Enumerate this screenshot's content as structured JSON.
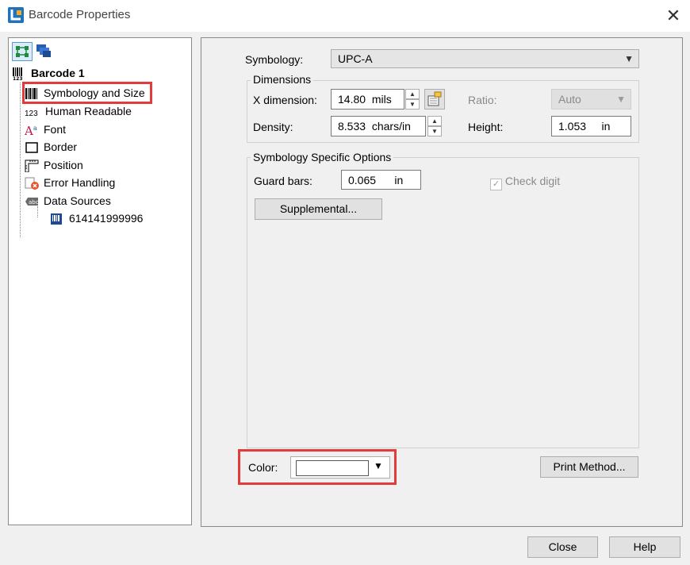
{
  "window": {
    "title": "Barcode Properties"
  },
  "tree": {
    "root": "Barcode 1",
    "items": [
      {
        "label": "Symbology and Size",
        "icon": "barcode-icon"
      },
      {
        "label": "Human Readable",
        "icon": "digits-icon",
        "prefix": "123"
      },
      {
        "label": "Font",
        "icon": "font-icon"
      },
      {
        "label": "Border",
        "icon": "border-icon"
      },
      {
        "label": "Position",
        "icon": "ruler-icon"
      },
      {
        "label": "Error Handling",
        "icon": "error-icon"
      },
      {
        "label": "Data Sources",
        "icon": "datasource-icon"
      }
    ],
    "child": {
      "label": "614141999996",
      "icon": "barcode-doc-icon"
    }
  },
  "symbology": {
    "label": "Symbology:",
    "value": "UPC-A"
  },
  "dimensions": {
    "title": "Dimensions",
    "x_label": "X dimension:",
    "x_value": "14.80",
    "x_unit": "mils",
    "ratio_label": "Ratio:",
    "ratio_value": "Auto",
    "density_label": "Density:",
    "density_value": "8.533",
    "density_unit": "chars/in",
    "height_label": "Height:",
    "height_value": "1.053",
    "height_unit": "in"
  },
  "options": {
    "title": "Symbology Specific Options",
    "guard_label": "Guard bars:",
    "guard_value": "0.065",
    "guard_unit": "in",
    "check_digit": "Check digit",
    "supplemental": "Supplemental..."
  },
  "color": {
    "label": "Color:"
  },
  "buttons": {
    "print_method": "Print Method...",
    "close": "Close",
    "help": "Help"
  },
  "colors": {
    "highlight": "#e23b3b",
    "selected_bg": "#d9ebf9"
  }
}
